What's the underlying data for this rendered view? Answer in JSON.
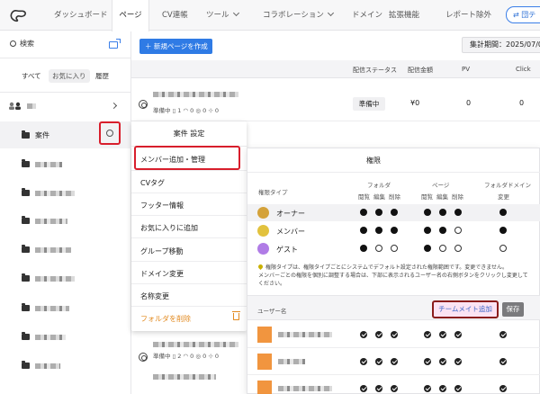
{
  "nav": {
    "tabs": [
      {
        "label": "ダッシュボード"
      },
      {
        "label": "ページ"
      },
      {
        "label": "CV連帳"
      },
      {
        "label": "ツール"
      },
      {
        "label": "コラボレーション"
      },
      {
        "label": "ドメイン"
      },
      {
        "label": "拡張機能"
      },
      {
        "label": "レポート除外"
      }
    ],
    "right_button": "団テ"
  },
  "sidebar": {
    "search_label": "検索",
    "tabs": [
      "すべて",
      "お気に入り",
      "履歴"
    ],
    "selected_folder": "案件"
  },
  "toolbar": {
    "new_page": "新規ページを作成",
    "period": "集計期間：2025/07/0"
  },
  "table": {
    "headers": [
      "配信ステータス",
      "配信金額",
      "PV",
      "Click"
    ],
    "row1": {
      "status": "準備中",
      "amount": "¥0",
      "pv": "0",
      "click": "0",
      "meta_status": "準備中",
      "meta_counts": [
        "1",
        "0",
        "0",
        "0"
      ]
    },
    "row2": {
      "meta_status": "準備中",
      "meta_counts": [
        "2",
        "0",
        "0",
        "0"
      ]
    }
  },
  "menu": {
    "title": "案件 設定",
    "items": [
      "メンバー追加・管理",
      "CVタグ",
      "フッター情報",
      "お気に入りに追加",
      "グループ移動",
      "ドメイン変更",
      "名称変更"
    ],
    "delete": "フォルダを削除"
  },
  "permissions": {
    "title": "権限",
    "role_type": "権限タイプ",
    "group_folder": "フォルダ",
    "group_page": "ページ",
    "group_folder_domain": "フォルダドメイン",
    "sub": {
      "view": "閲覧",
      "edit": "編集",
      "delete": "削除",
      "change": "変更"
    },
    "roles": [
      {
        "name": "オーナー",
        "color": "#d4a23a",
        "perms": [
          1,
          1,
          1,
          1,
          1,
          1,
          1
        ]
      },
      {
        "name": "メンバー",
        "color": "#e2c23e",
        "perms": [
          1,
          1,
          1,
          1,
          1,
          0,
          1
        ]
      },
      {
        "name": "ゲスト",
        "color": "#b07ce6",
        "perms": [
          1,
          0,
          0,
          1,
          0,
          0,
          0
        ]
      }
    ],
    "note_line1": "権限タイプは、権限タイプごとにシステムでデフォルト設定された権限範囲です。変更できません。",
    "note_line2": "メンバーごとの権限を個別に調整する場合は、下部に表示されるユーザー名の右側ボタンをクリックし変更してください。",
    "user_header": "ユーザー名",
    "add_teammate": "チームメイト追加",
    "save": "保存"
  },
  "colors": {
    "accent": "#2f7be5",
    "highlight_red": "#d81e2c",
    "danger_orange": "#e28a20"
  }
}
